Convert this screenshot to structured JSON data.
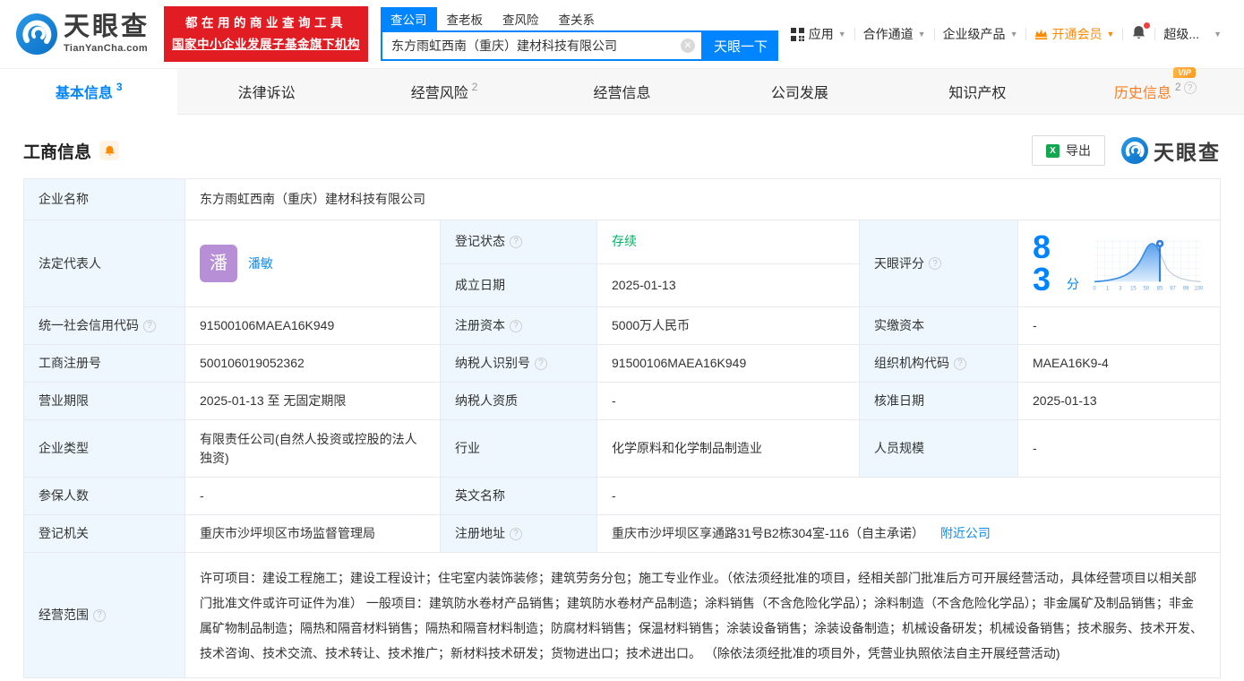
{
  "header": {
    "logo": {
      "brand": "天眼查",
      "domain": "TianYanCha.com"
    },
    "slogan": {
      "line1": "都在用的商业查询工具",
      "line2": "国家中小企业发展子基金旗下机构"
    },
    "search": {
      "tabs": [
        {
          "label": "查公司"
        },
        {
          "label": "查老板"
        },
        {
          "label": "查风险"
        },
        {
          "label": "查关系"
        }
      ],
      "input_value": "东方雨虹西南（重庆）建材科技有限公司",
      "button_label": "天眼一下"
    },
    "nav": {
      "apps": "应用",
      "channel": "合作通道",
      "enterprise": "企业级产品",
      "member": "开通会员",
      "super": "超级..."
    }
  },
  "page_tabs": [
    {
      "label": "基本信息",
      "count": "3"
    },
    {
      "label": "法律诉讼",
      "count": ""
    },
    {
      "label": "经营风险",
      "count": "2"
    },
    {
      "label": "经营信息",
      "count": ""
    },
    {
      "label": "公司发展",
      "count": ""
    },
    {
      "label": "知识产权",
      "count": ""
    },
    {
      "label": "历史信息",
      "count": "2",
      "vip": "VIP"
    }
  ],
  "section": {
    "title": "工商信息",
    "export_label": "导出",
    "logo_text": "天眼查"
  },
  "fields": {
    "company_name": {
      "label": "企业名称",
      "value": "东方雨虹西南（重庆）建材科技有限公司"
    },
    "legal_rep": {
      "label": "法定代表人",
      "name": "潘敏",
      "avatar": "潘"
    },
    "reg_status": {
      "label": "登记状态",
      "value": "存续"
    },
    "est_date": {
      "label": "成立日期",
      "value": "2025-01-13"
    },
    "score": {
      "label": "天眼评分",
      "value": "83",
      "unit": "分",
      "axis": [
        "0",
        "1",
        "3",
        "15",
        "50",
        "85",
        "97",
        "99",
        "100"
      ]
    },
    "credit_code": {
      "label": "统一社会信用代码",
      "value": "91500106MAEA16K949"
    },
    "reg_capital": {
      "label": "注册资本",
      "value": "5000万人民币"
    },
    "paid_capital": {
      "label": "实缴资本",
      "value": "-"
    },
    "reg_number": {
      "label": "工商注册号",
      "value": "500106019052362"
    },
    "taxpayer_id": {
      "label": "纳税人识别号",
      "value": "91500106MAEA16K949"
    },
    "org_code": {
      "label": "组织机构代码",
      "value": "MAEA16K9-4"
    },
    "business_term": {
      "label": "营业期限",
      "value": "2025-01-13 至 无固定期限"
    },
    "taxpayer_quality": {
      "label": "纳税人资质",
      "value": "-"
    },
    "approval_date": {
      "label": "核准日期",
      "value": "2025-01-13"
    },
    "company_type": {
      "label": "企业类型",
      "value": "有限责任公司(自然人投资或控股的法人独资)"
    },
    "industry": {
      "label": "行业",
      "value": "化学原料和化学制品制造业"
    },
    "staff_size": {
      "label": "人员规模",
      "value": "-"
    },
    "insured_count": {
      "label": "参保人数",
      "value": "-"
    },
    "english_name": {
      "label": "英文名称",
      "value": "-"
    },
    "reg_authority": {
      "label": "登记机关",
      "value": "重庆市沙坪坝区市场监督管理局"
    },
    "reg_address": {
      "label": "注册地址",
      "value": "重庆市沙坪坝区享通路31号B2栋304室-116（自主承诺）",
      "link": "附近公司"
    },
    "business_scope": {
      "label": "经营范围",
      "value": "许可项目：建设工程施工；建设工程设计；住宅室内装饰装修；建筑劳务分包；施工专业作业。（依法须经批准的项目，经相关部门批准后方可开展经营活动，具体经营项目以相关部门批准文件或许可证件为准） 一般项目：建筑防水卷材产品销售；建筑防水卷材产品制造；涂料销售（不含危险化学品）；涂料制造（不含危险化学品）；非金属矿及制品销售；非金属矿物制品制造；隔热和隔音材料销售；隔热和隔音材料制造；防腐材料销售；保温材料销售；涂装设备销售；涂装设备制造；机械设备研发；机械设备销售；技术服务、技术开发、技术咨询、技术交流、技术转让、技术推广；新材料技术研发；货物进出口；技术进出口。 （除依法须经批准的项目外，凭营业执照依法自主开展经营活动)"
    }
  },
  "colors": {
    "brand_blue": "#0084ff",
    "banner_red": "#e11d23",
    "vip_orange": "#ff8a00",
    "status_green": "#00b365",
    "link_blue": "#128bed",
    "avatar_purple": "#b78fd6",
    "history_tab_orange": "#ff7d20"
  }
}
